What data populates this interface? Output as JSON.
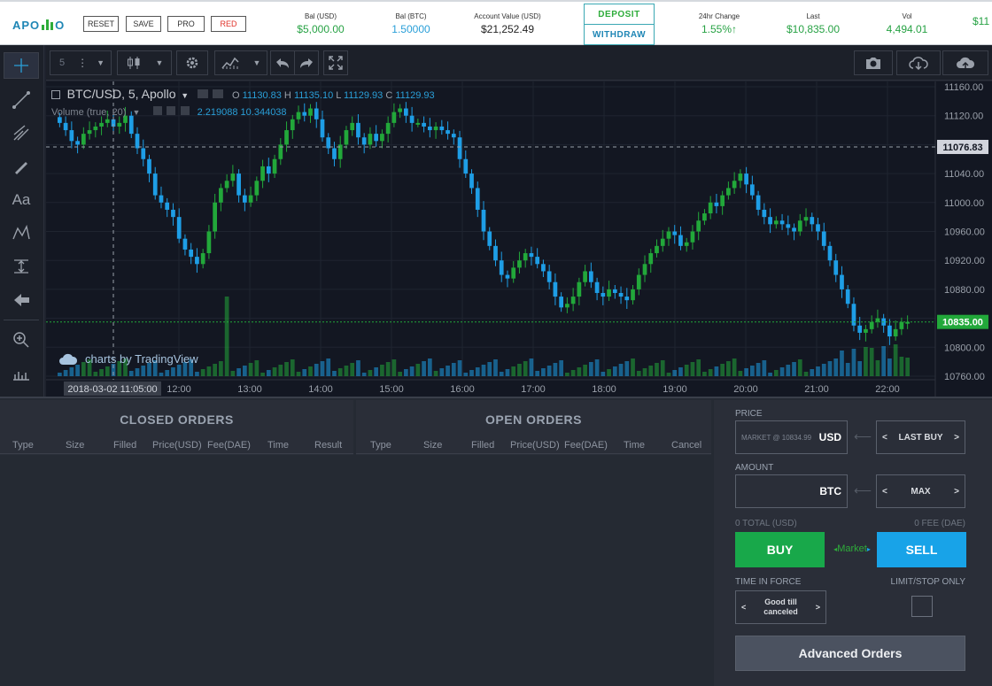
{
  "header": {
    "logo_text_left": "APO",
    "logo_text_right": "O",
    "buttons": {
      "reset": "RESET",
      "save": "SAVE",
      "pro": "PRO",
      "red": "RED"
    },
    "stats": [
      {
        "label": "Bal (USD)",
        "value": "$5,000.00",
        "color": "#27a244"
      },
      {
        "label": "Bal (BTC)",
        "value": "1.50000",
        "color": "#2a9fd8"
      },
      {
        "label": "Account Value (USD)",
        "value": "$21,252.49",
        "color": "#222222"
      },
      {
        "label": "24hr Change",
        "value": "1.55%↑",
        "color": "#27a244"
      },
      {
        "label": "Last",
        "value": "$10,835.00",
        "color": "#27a244"
      },
      {
        "label": "Vol",
        "value": "4,494.01",
        "color": "#27a244"
      },
      {
        "label": "",
        "value": "$11",
        "color": "#27a244"
      }
    ],
    "deposit": "DEPOSIT",
    "withdraw": "WITHDRAW"
  },
  "chart_toolbar": {
    "interval": "5"
  },
  "chart": {
    "symbol_title": "BTC/USD, 5, Apollo",
    "ohlc": {
      "o_label": "O",
      "o": "11130.83",
      "h_label": "H",
      "h": "11135.10",
      "l_label": "L",
      "l": "11129.93",
      "c_label": "C",
      "c": "11129.93"
    },
    "volume_label": "Volume (true, 20)",
    "volume_values": "2.219088  10.344038",
    "watermark": "charts by TradingView",
    "crosshair_time": "2018-03-02 11:05:00",
    "current_price_tag": "10835.00",
    "crosshair_price_tag": "11076.83",
    "colors": {
      "up": "#22a83a",
      "down": "#1e9ee6",
      "background": "#131722"
    }
  },
  "chart_data": {
    "type": "candlestick",
    "title": "BTC/USD, 5, Apollo",
    "y_ticks": [
      "11160.00",
      "11120.00",
      "11080.00",
      "11040.00",
      "11000.00",
      "10960.00",
      "10920.00",
      "10880.00",
      "10840.00",
      "10800.00",
      "10760.00"
    ],
    "x_ticks": [
      "12:00",
      "13:00",
      "14:00",
      "15:00",
      "16:00",
      "17:00",
      "18:00",
      "19:00",
      "20:00",
      "21:00",
      "22:00"
    ],
    "ylim": [
      10760,
      11160
    ],
    "series_close_approx": [
      11110,
      11100,
      11085,
      11080,
      11095,
      11100,
      11105,
      11110,
      11115,
      11105,
      11110,
      11120,
      11095,
      11075,
      11060,
      11040,
      11010,
      11000,
      10990,
      10980,
      10950,
      10935,
      10925,
      10915,
      10930,
      10960,
      11000,
      11020,
      11030,
      11040,
      11010,
      11000,
      11010,
      11030,
      11050,
      11040,
      11060,
      11080,
      11100,
      11115,
      11125,
      11120,
      11130,
      11115,
      11090,
      11075,
      11060,
      11080,
      11100,
      11110,
      11090,
      11080,
      11095,
      11085,
      11095,
      11110,
      11125,
      11130,
      11120,
      11110,
      11110,
      11105,
      11100,
      11105,
      11100,
      11095,
      11090,
      11060,
      11040,
      11020,
      10990,
      10960,
      10940,
      10920,
      10900,
      10895,
      10910,
      10920,
      10930,
      10925,
      10915,
      10905,
      10890,
      10870,
      10855,
      10860,
      10870,
      10890,
      10905,
      10890,
      10875,
      10870,
      10880,
      10875,
      10870,
      10865,
      10880,
      10900,
      10915,
      10930,
      10940,
      10950,
      10960,
      10955,
      10940,
      10945,
      10960,
      10975,
      10985,
      11000,
      10995,
      11010,
      11020,
      11030,
      11040,
      11025,
      11010,
      10990,
      10980,
      10970,
      10975,
      10970,
      10965,
      10960,
      10975,
      10980,
      10970,
      10960,
      10940,
      10920,
      10900,
      10880,
      10860,
      10830,
      10820,
      10825,
      10835,
      10840,
      10830,
      10815,
      10825,
      10835,
      10835
    ]
  },
  "closed_orders": {
    "title": "CLOSED ORDERS",
    "columns": [
      "Type",
      "Size",
      "Filled",
      "Price(USD)",
      "Fee(DAE)",
      "Time",
      "Result"
    ]
  },
  "open_orders": {
    "title": "OPEN ORDERS",
    "columns": [
      "Type",
      "Size",
      "Filled",
      "Price(USD)",
      "Fee(DAE)",
      "Time",
      "Cancel"
    ]
  },
  "trade": {
    "price_label": "PRICE",
    "price_placeholder": "MARKET @ 10834.99",
    "price_unit": "USD",
    "price_mode": "LAST BUY",
    "amount_label": "AMOUNT",
    "amount_unit": "BTC",
    "amount_mode": "MAX",
    "total": "0 TOTAL (USD)",
    "fee": "0 FEE (DAE)",
    "buy": "BUY",
    "market": "Market",
    "sell": "SELL",
    "tif_label": "TIME IN FORCE",
    "tif_value": "Good till canceled",
    "limit_only": "LIMIT/STOP ONLY",
    "advanced": "Advanced Orders",
    "colors": {
      "buy": "#18a84a",
      "sell": "#18a3e8"
    }
  }
}
